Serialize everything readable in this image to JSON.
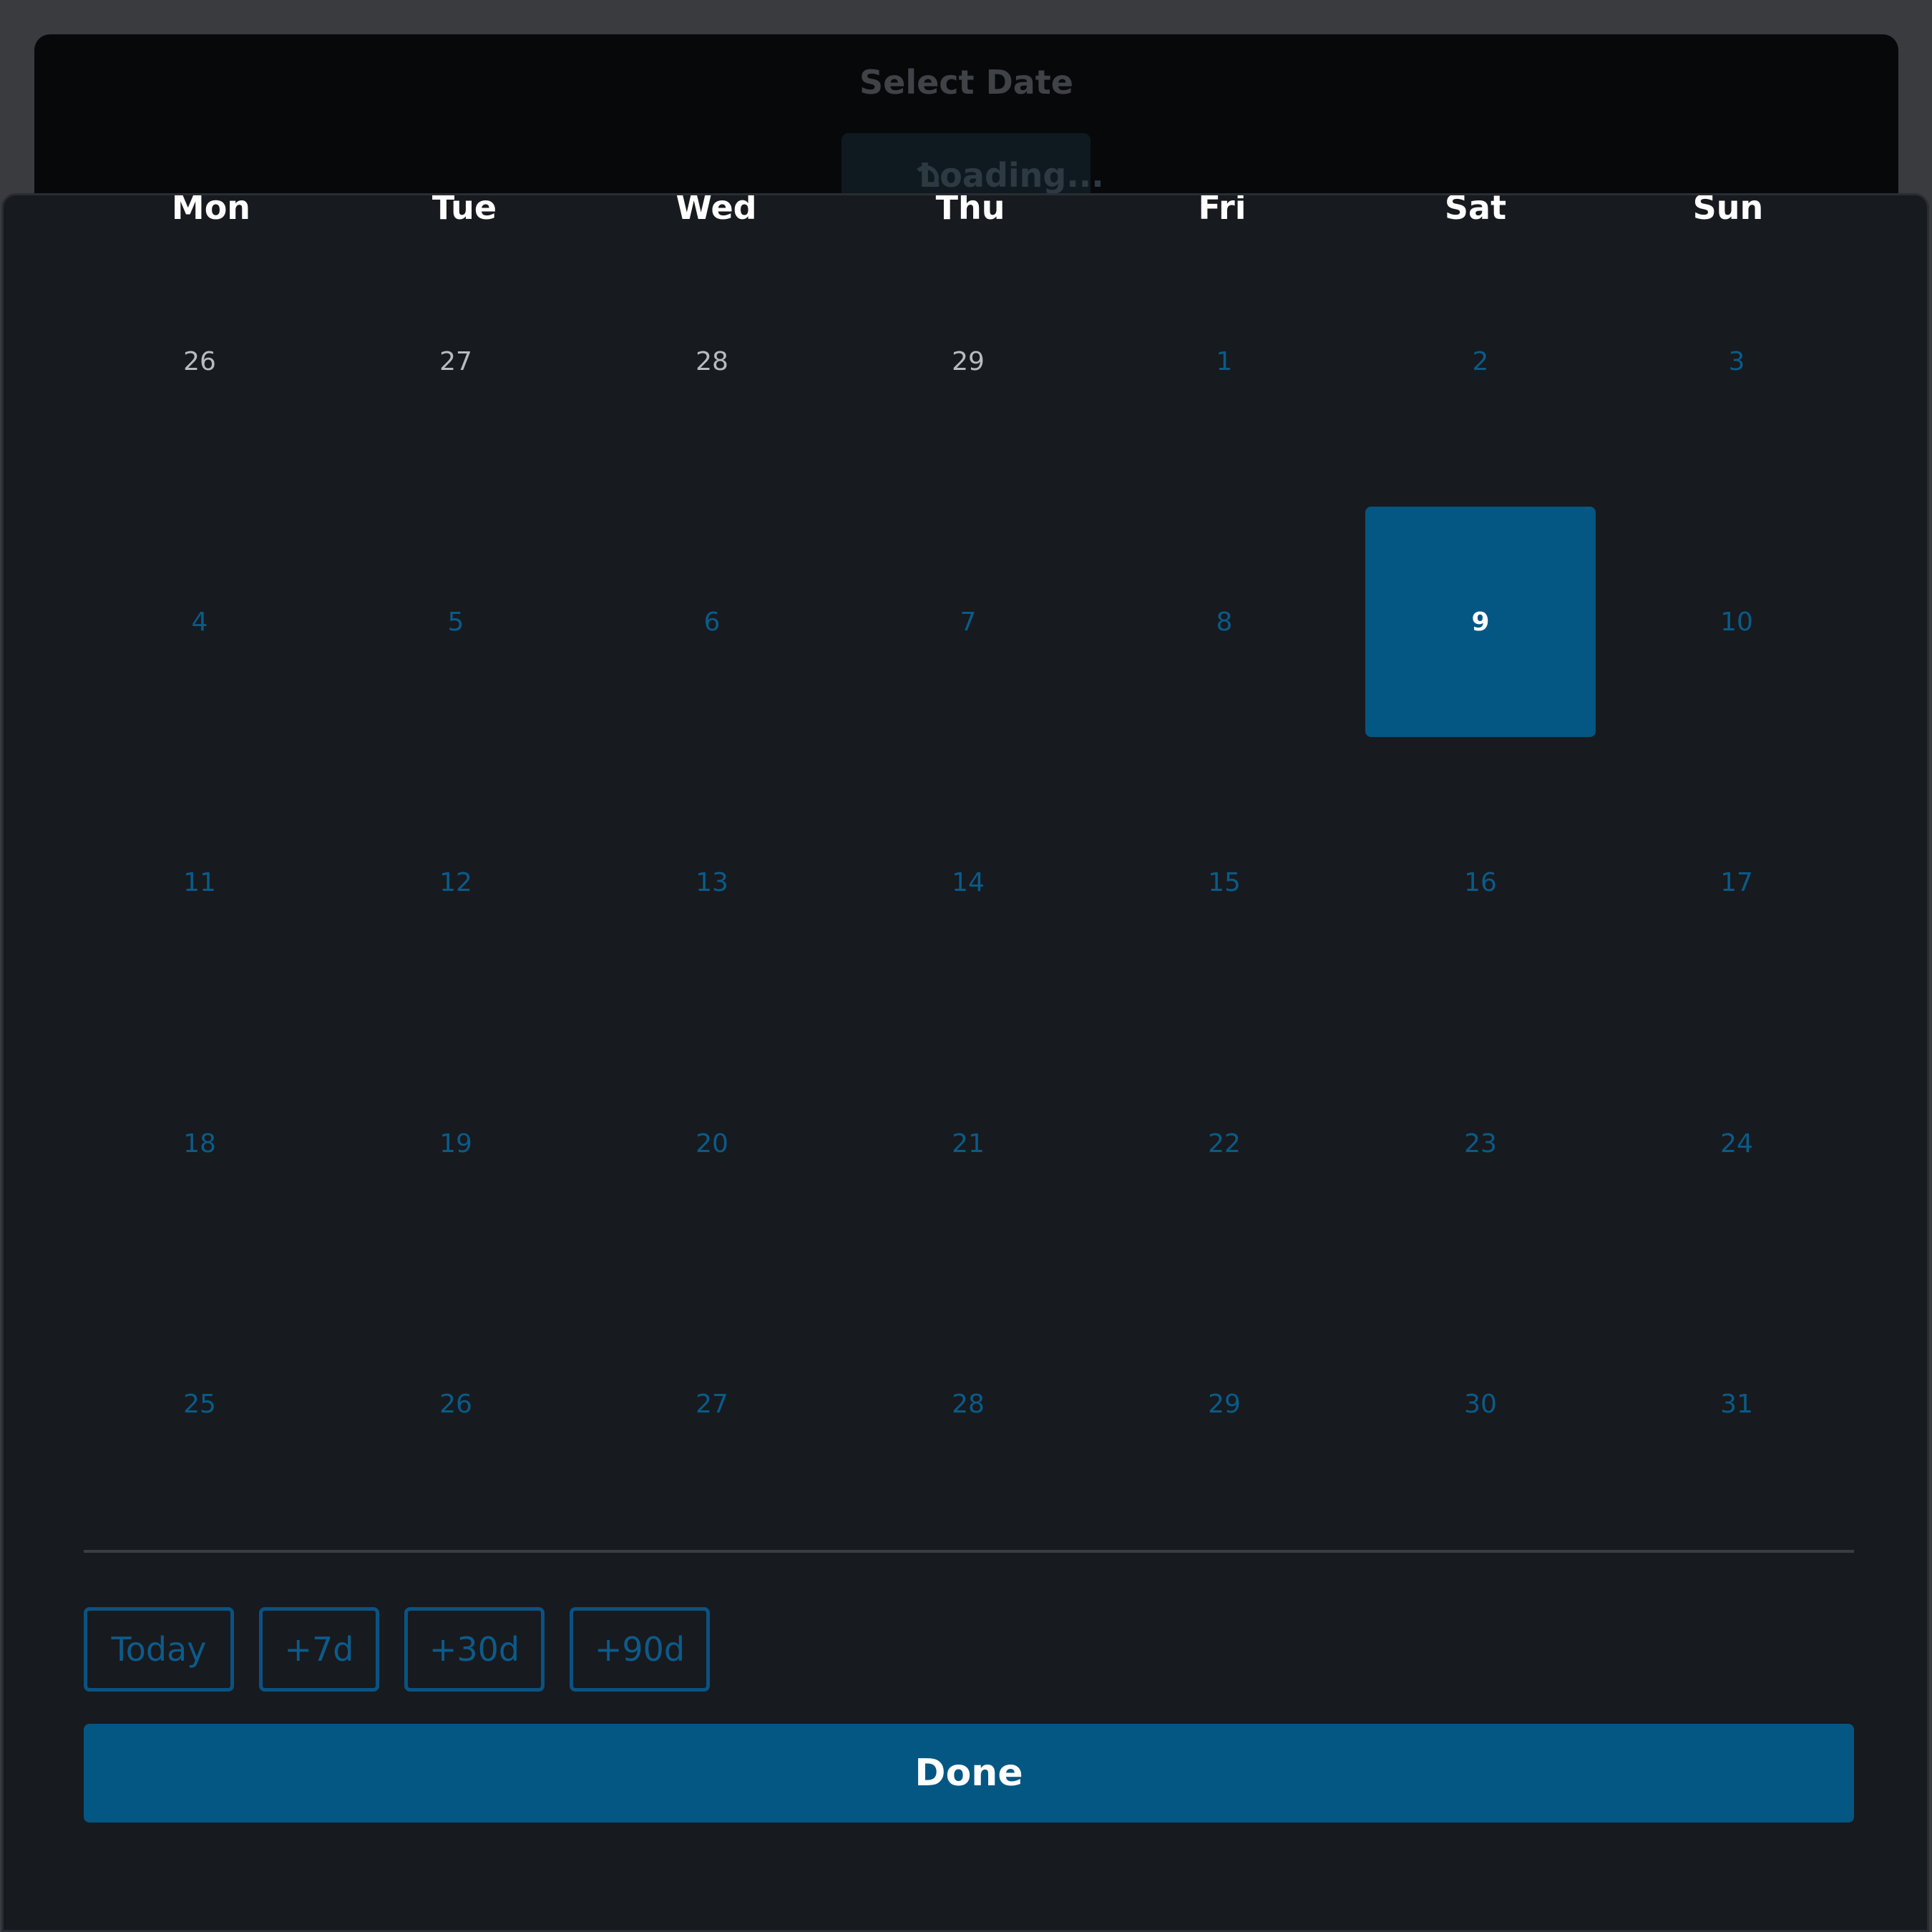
{
  "background_dialog": {
    "title": "Select Date",
    "loading_label": "Loading..."
  },
  "calendar": {
    "weekdays": [
      "Mon",
      "Tue",
      "Wed",
      "Thu",
      "Fri",
      "Sat",
      "Sun"
    ],
    "weeks": [
      [
        {
          "d": "26",
          "out": true
        },
        {
          "d": "27",
          "out": true
        },
        {
          "d": "28",
          "out": true
        },
        {
          "d": "29",
          "out": true
        },
        {
          "d": "1"
        },
        {
          "d": "2"
        },
        {
          "d": "3"
        }
      ],
      [
        {
          "d": "4"
        },
        {
          "d": "5"
        },
        {
          "d": "6"
        },
        {
          "d": "7"
        },
        {
          "d": "8"
        },
        {
          "d": "9",
          "selected": true
        },
        {
          "d": "10"
        }
      ],
      [
        {
          "d": "11"
        },
        {
          "d": "12"
        },
        {
          "d": "13"
        },
        {
          "d": "14"
        },
        {
          "d": "15"
        },
        {
          "d": "16"
        },
        {
          "d": "17"
        }
      ],
      [
        {
          "d": "18"
        },
        {
          "d": "19"
        },
        {
          "d": "20"
        },
        {
          "d": "21"
        },
        {
          "d": "22"
        },
        {
          "d": "23"
        },
        {
          "d": "24"
        }
      ],
      [
        {
          "d": "25"
        },
        {
          "d": "26"
        },
        {
          "d": "27"
        },
        {
          "d": "28"
        },
        {
          "d": "29"
        },
        {
          "d": "30"
        },
        {
          "d": "31"
        }
      ]
    ],
    "selected_day": "9"
  },
  "quick_actions": [
    "Today",
    "+7d",
    "+30d",
    "+90d"
  ],
  "done_label": "Done",
  "colors": {
    "accent": "#045783",
    "sheet_bg": "#171a1f",
    "page_bg": "#3a3b3e"
  }
}
